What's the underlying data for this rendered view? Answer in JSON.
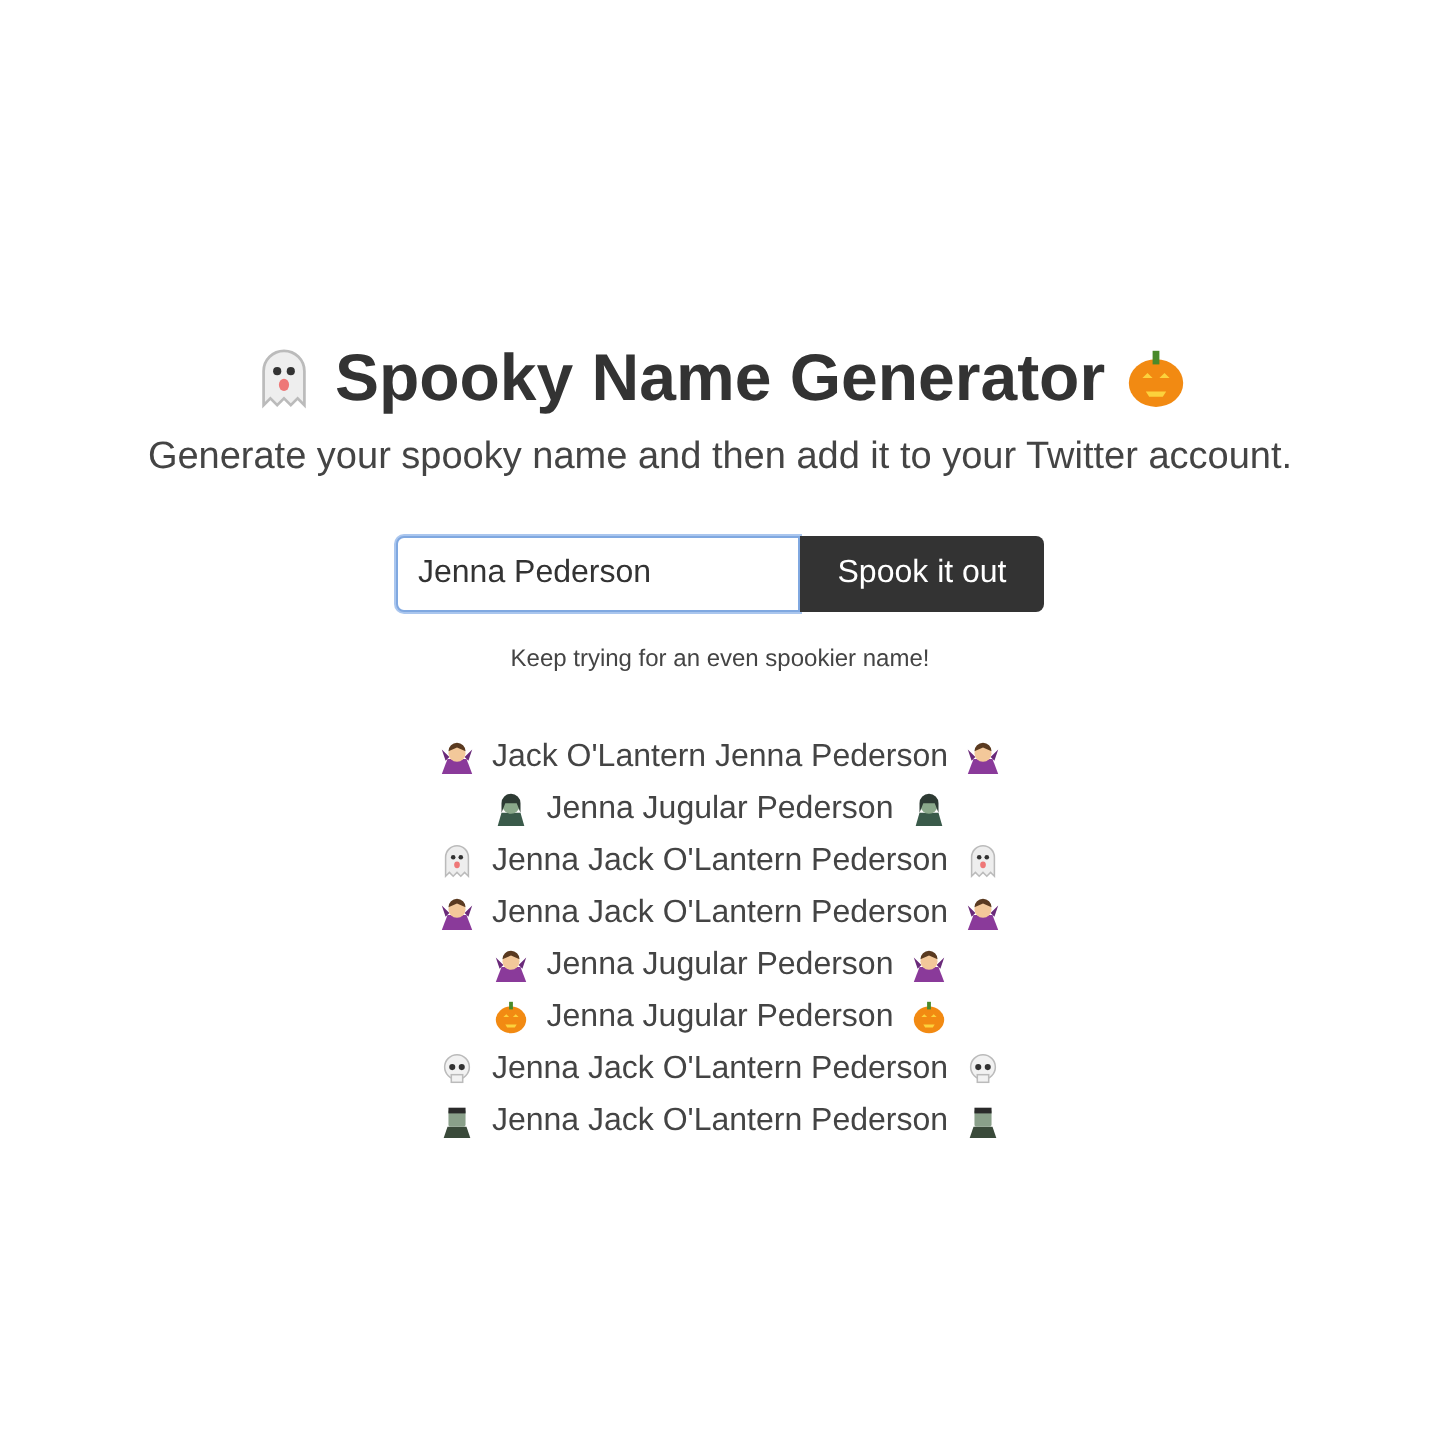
{
  "title": {
    "text": "Spooky Name Generator",
    "icons": [
      {
        "kind": "ghost"
      },
      {
        "kind": "pumpkin"
      }
    ]
  },
  "subtitle": "Generate your spooky name and then add it to your Twitter account.",
  "form": {
    "value": "Jenna Pederson",
    "button": "Spook it out"
  },
  "hint": "Keep trying for an even spookier name!",
  "names": [
    {
      "kind": "vampire",
      "text": "Jack O'Lantern Jenna Pederson"
    },
    {
      "kind": "zombie",
      "text": "Jenna Jugular Pederson"
    },
    {
      "kind": "ghost",
      "text": "Jenna Jack O'Lantern Pederson"
    },
    {
      "kind": "vampire",
      "text": "Jenna Jack O'Lantern Pederson"
    },
    {
      "kind": "vampire",
      "text": "Jenna Jugular Pederson"
    },
    {
      "kind": "pumpkin",
      "text": "Jenna Jugular Pederson"
    },
    {
      "kind": "skull",
      "text": "Jenna Jack O'Lantern Pederson"
    },
    {
      "kind": "monster",
      "text": "Jenna Jack O'Lantern Pederson"
    }
  ]
}
